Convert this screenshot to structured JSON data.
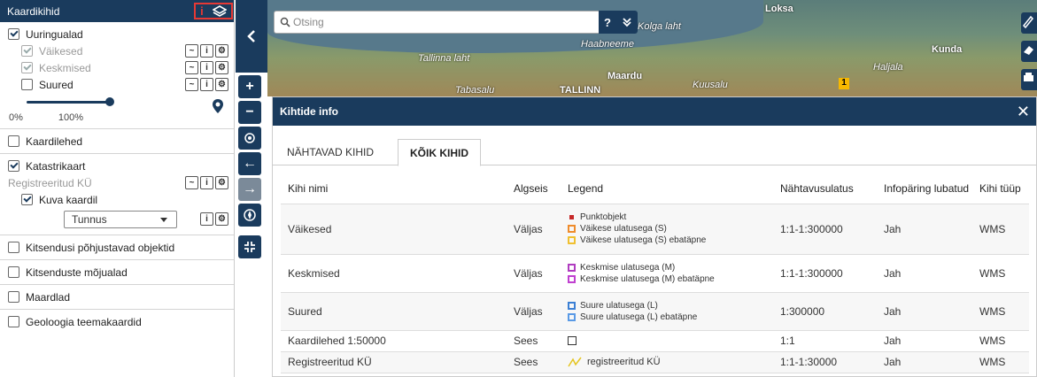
{
  "sidebar": {
    "title": "Kaardikihid",
    "info_icon": "i",
    "groups": [
      {
        "label": "Uuringualad",
        "checked": true,
        "children": [
          {
            "label": "Väikesed",
            "checked": true
          },
          {
            "label": "Keskmised",
            "checked": true
          },
          {
            "label": "Suured",
            "checked": false
          }
        ],
        "opacity_min": "0%",
        "opacity_max": "100%"
      },
      {
        "label": "Kaardilehed",
        "checked": false
      },
      {
        "label": "Katastrikaart",
        "checked": true,
        "sublabel": "Registreeritud KÜ",
        "show_on_map": "Kuva kaardil",
        "select_value": "Tunnus"
      },
      {
        "label": "Kitsendusi põhjustavad objektid",
        "checked": false
      },
      {
        "label": "Kitsenduste mõjualad",
        "checked": false
      },
      {
        "label": "Maardlad",
        "checked": false
      },
      {
        "label": "Geoloogia teemakaardid",
        "checked": false
      }
    ]
  },
  "map": {
    "search_placeholder": "Otsing",
    "help_label": "?",
    "places": [
      "Kolga laht",
      "Loksa",
      "Kunda",
      "Haabneeme",
      "Tallinna laht",
      "Maardu",
      "Haljala",
      "Tabasalu",
      "TALLINN",
      "Kuusalu"
    ],
    "route_number": "1"
  },
  "dialog": {
    "title": "Kihtide info",
    "tabs": [
      {
        "label": "NÄHTAVAD KIHID",
        "active": false
      },
      {
        "label": "KÕIK KIHID",
        "active": true
      }
    ],
    "columns": [
      "Kihi nimi",
      "Algseis",
      "Legend",
      "Nähtavusulatus",
      "Infopäring lubatud",
      "Kihi tüüp"
    ],
    "rows": [
      {
        "name": "Väikesed",
        "state": "Väljas",
        "legend": [
          "Punktobjekt",
          "Väikese ulatusega (S)",
          "Väikese ulatusega (S) ebatäpne"
        ],
        "range": "1:1-1:300000",
        "query": "Jah",
        "type": "WMS"
      },
      {
        "name": "Keskmised",
        "state": "Väljas",
        "legend": [
          "Keskmise ulatusega (M)",
          "Keskmise ulatusega (M) ebatäpne"
        ],
        "range": "1:1-1:300000",
        "query": "Jah",
        "type": "WMS"
      },
      {
        "name": "Suured",
        "state": "Väljas",
        "legend": [
          "Suure ulatusega (L)",
          "Suure ulatusega (L) ebatäpne"
        ],
        "range": "1:300000",
        "query": "Jah",
        "type": "WMS"
      },
      {
        "name": "Kaardilehed 1:50000",
        "state": "Sees",
        "legend": [],
        "range": "1:1",
        "query": "Jah",
        "type": "WMS"
      },
      {
        "name": "Registreeritud KÜ",
        "state": "Sees",
        "legend": [
          "registreeritud KÜ"
        ],
        "range": "1:1-1:30000",
        "query": "Jah",
        "type": "WMS"
      }
    ]
  },
  "colors": {
    "primary": "#1a3b5d",
    "highlight": "#e53935"
  }
}
